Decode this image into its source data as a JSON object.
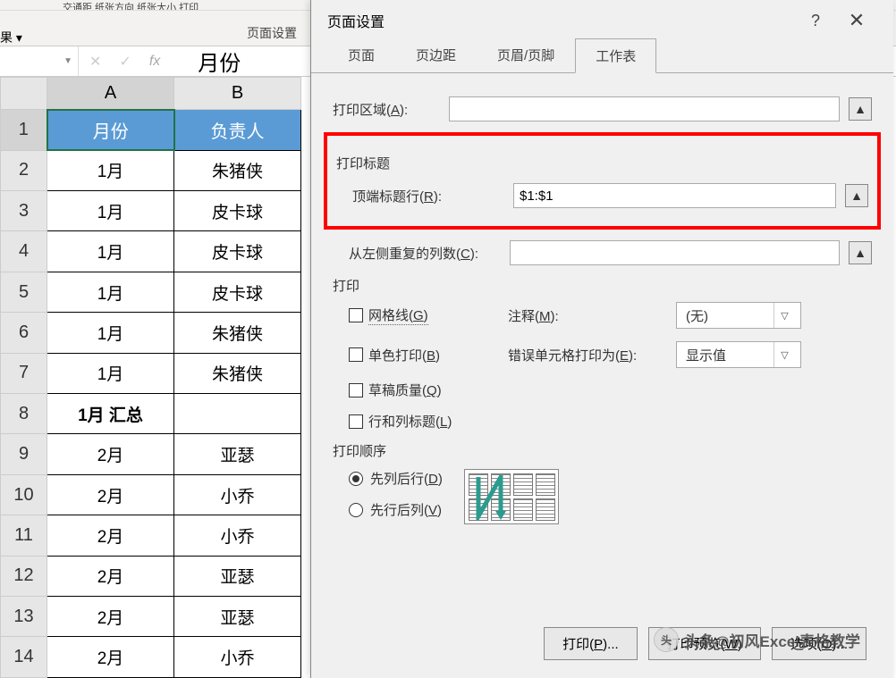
{
  "ribbon": {
    "fragment": "交通距 纸张方向 纸张大小 打印",
    "section_label": "页面设置",
    "left_label_fragment": "果 ▾"
  },
  "formula_bar": {
    "cancel": "✕",
    "confirm": "✓",
    "fx": "fx",
    "content": "月份"
  },
  "sheet": {
    "col_headers": [
      "A",
      "B"
    ],
    "header_row": [
      "月份",
      "负责人"
    ],
    "rows": [
      [
        "1月",
        "朱猪侠"
      ],
      [
        "1月",
        "皮卡球"
      ],
      [
        "1月",
        "皮卡球"
      ],
      [
        "1月",
        "皮卡球"
      ],
      [
        "1月",
        "朱猪侠"
      ],
      [
        "1月",
        "朱猪侠"
      ],
      [
        "1月  汇总",
        ""
      ],
      [
        "2月",
        "亚瑟"
      ],
      [
        "2月",
        "小乔"
      ],
      [
        "2月",
        "小乔"
      ],
      [
        "2月",
        "亚瑟"
      ],
      [
        "2月",
        "亚瑟"
      ],
      [
        "2月",
        "小乔"
      ]
    ]
  },
  "dialog": {
    "title": "页面设置",
    "help": "?",
    "close": "✕",
    "tabs": [
      "页面",
      "页边距",
      "页眉/页脚",
      "工作表"
    ],
    "active_tab": 3,
    "print_area_label": "打印区域(A):",
    "print_area_value": "",
    "titles_label": "打印标题",
    "top_row_label": "顶端标题行(R):",
    "top_row_value": "$1:$1",
    "left_col_label": "从左侧重复的列数(C):",
    "left_col_value": "",
    "print_label": "打印",
    "gridlines": "网格线(G)",
    "bw": "单色打印(B)",
    "draft": "草稿质量(Q)",
    "row_col_headings": "行和列标题(L)",
    "comments_label": "注释(M):",
    "comments_value": "(无)",
    "errors_label": "错误单元格打印为(E):",
    "errors_value": "显示值",
    "order_label": "打印顺序",
    "order_down": "先列后行(D)",
    "order_over": "先行后列(V)",
    "btn_print": "打印(P)...",
    "btn_preview": "打印预览(W)",
    "btn_options": "选项(O)..."
  },
  "watermark": "头条@初风Excel表格教学"
}
